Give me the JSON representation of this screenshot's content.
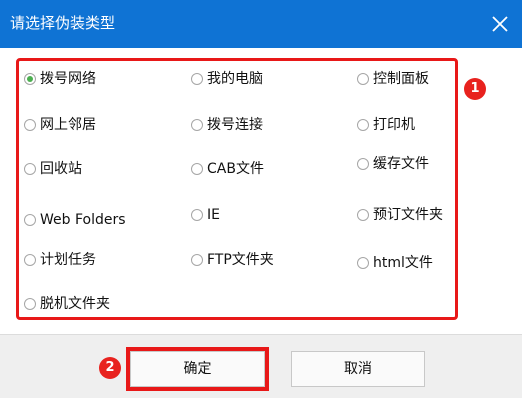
{
  "dialog": {
    "title": "请选择伪装类型",
    "close_icon": "close-icon"
  },
  "options": [
    {
      "label": "拨号网络",
      "checked": true
    },
    {
      "label": "我的电脑",
      "checked": false
    },
    {
      "label": "控制面板",
      "checked": false
    },
    {
      "label": "网上邻居",
      "checked": false
    },
    {
      "label": "拨号连接",
      "checked": false
    },
    {
      "label": "打印机",
      "checked": false
    },
    {
      "label": "回收站",
      "checked": false
    },
    {
      "label": "CAB文件",
      "checked": false
    },
    {
      "label": "缓存文件",
      "checked": false
    },
    {
      "label": "Web Folders",
      "checked": false
    },
    {
      "label": "IE",
      "checked": false
    },
    {
      "label": "预订文件夹",
      "checked": false
    },
    {
      "label": "计划任务",
      "checked": false
    },
    {
      "label": "FTP文件夹",
      "checked": false
    },
    {
      "label": "html文件",
      "checked": false
    },
    {
      "label": "脱机文件夹",
      "checked": false
    }
  ],
  "badges": {
    "one": "1",
    "two": "2"
  },
  "footer": {
    "ok_label": "确定",
    "cancel_label": "取消"
  },
  "colors": {
    "titlebar": "#0f73d4",
    "highlight": "#e81818",
    "radio_checked": "#4caf50"
  }
}
